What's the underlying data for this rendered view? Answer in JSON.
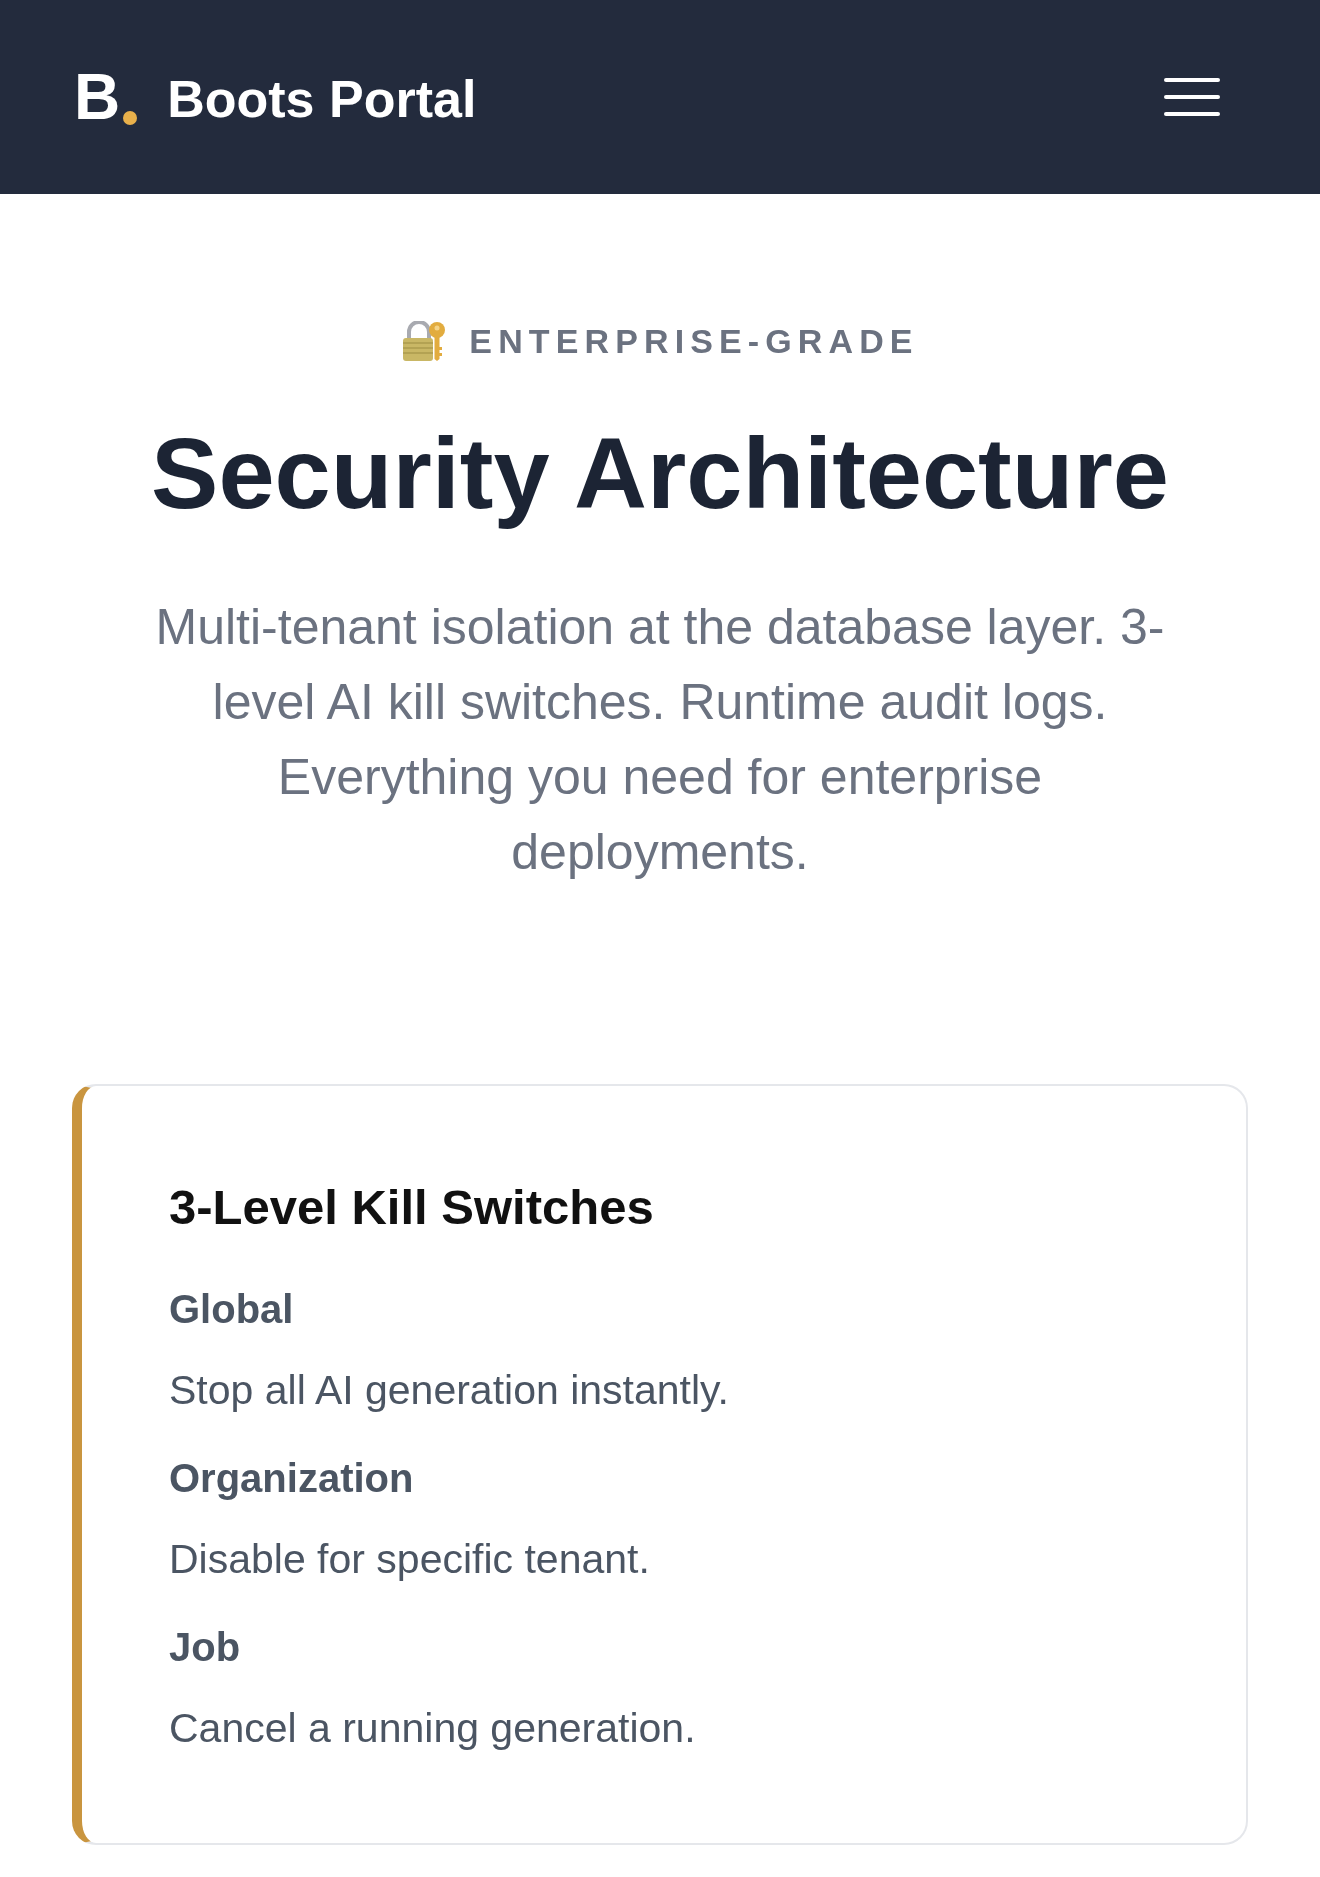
{
  "header": {
    "logo": {
      "mark": "B"
    },
    "title": "Boots Portal"
  },
  "hero": {
    "eyebrow": "ENTERPRISE-GRADE",
    "title": "Security Architecture",
    "description": "Multi-tenant isolation at the database layer. 3-level AI kill switches. Runtime audit logs. Everything you need for enterprise deployments."
  },
  "card": {
    "title": "3-Level Kill Switches",
    "items": [
      {
        "label": "Global",
        "description": "Stop all AI generation instantly."
      },
      {
        "label": "Organization",
        "description": "Disable for specific tenant."
      },
      {
        "label": "Job",
        "description": "Cancel a running generation."
      }
    ]
  }
}
